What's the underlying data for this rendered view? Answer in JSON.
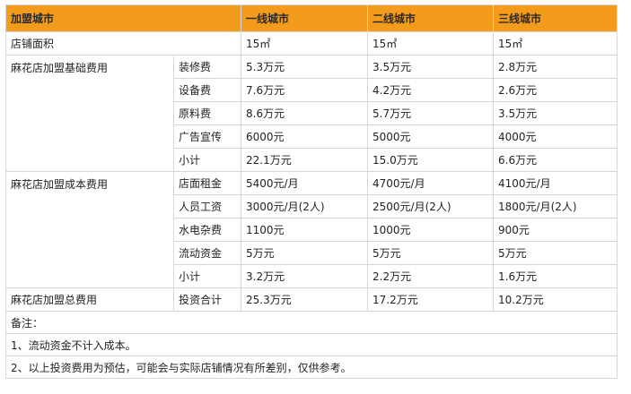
{
  "header": [
    "加盟城市",
    "一线城市",
    "二线城市",
    "三线城市"
  ],
  "area": {
    "label": "店铺面积",
    "values": [
      "15㎡",
      "15㎡",
      "15㎡"
    ]
  },
  "groups": [
    {
      "label": "麻花店加盟基础费用",
      "rows": [
        {
          "item": "装修费",
          "values": [
            "5.3万元",
            "3.5万元",
            "2.8万元"
          ]
        },
        {
          "item": "设备费",
          "values": [
            "7.6万元",
            "4.2万元",
            "2.6万元"
          ]
        },
        {
          "item": "原料费",
          "values": [
            "8.6万元",
            "5.7万元",
            "3.5万元"
          ]
        },
        {
          "item": "广告宣传",
          "values": [
            "6000元",
            "5000元",
            "4000元"
          ]
        },
        {
          "item": "小计",
          "values": [
            "22.1万元",
            "15.0万元",
            "6.6万元"
          ]
        }
      ]
    },
    {
      "label": "麻花店加盟成本费用",
      "rows": [
        {
          "item": "店面租金",
          "values": [
            "5400元/月",
            "4700元/月",
            "4100元/月"
          ]
        },
        {
          "item": "人员工资",
          "values": [
            "3000元/月(2人)",
            "2500元/月(2人)",
            "1800元/月(2人)"
          ]
        },
        {
          "item": "水电杂费",
          "values": [
            "1100元",
            "1000元",
            "900元"
          ]
        },
        {
          "item": "流动资金",
          "values": [
            "5万元",
            "5万元",
            "5万元"
          ]
        },
        {
          "item": "小计",
          "values": [
            "3.2万元",
            "2.2万元",
            "1.6万元"
          ]
        }
      ]
    },
    {
      "label": "麻花店加盟总费用",
      "rows": [
        {
          "item": "投资合计",
          "values": [
            "25.3万元",
            "17.2万元",
            "10.2万元"
          ]
        }
      ]
    }
  ],
  "notes": [
    "备注：",
    "1、流动资金不计入成本。",
    "2、以上投资费用为预估，可能会与实际店铺情况有所差别，仅供参考。"
  ]
}
